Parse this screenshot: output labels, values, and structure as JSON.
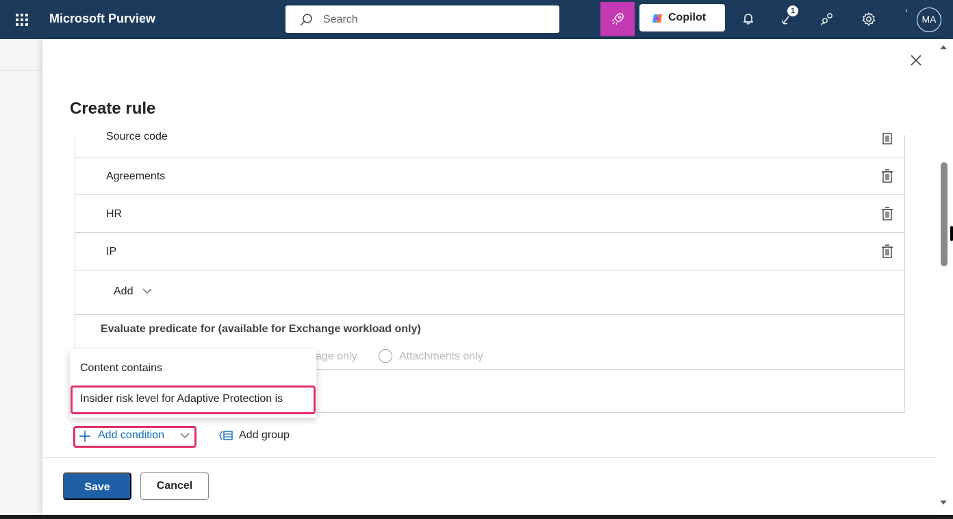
{
  "app": {
    "title": "Microsoft Purview"
  },
  "search": {
    "placeholder": "Search"
  },
  "header": {
    "copilot_label": "Copilot",
    "notification_count": "1",
    "avatar_initials": "MA",
    "accent_color": "#c239b3",
    "bar_color": "#1b3a5c"
  },
  "panel": {
    "title": "Create rule",
    "rows": [
      {
        "label": "Source code"
      },
      {
        "label": "Agreements"
      },
      {
        "label": "HR"
      },
      {
        "label": "IP"
      }
    ],
    "add_label": "Add",
    "evaluate": {
      "label": "Evaluate predicate for (available for Exchange workload only)",
      "option_partial": "age only",
      "option_attachments": "Attachments only"
    },
    "flyout": {
      "items": [
        "Content contains",
        "Insider risk level for Adaptive Protection is"
      ]
    },
    "add_condition_label": "Add condition",
    "add_group_label": "Add group",
    "save_label": "Save",
    "cancel_label": "Cancel"
  },
  "highlight_color": "#e3306a"
}
